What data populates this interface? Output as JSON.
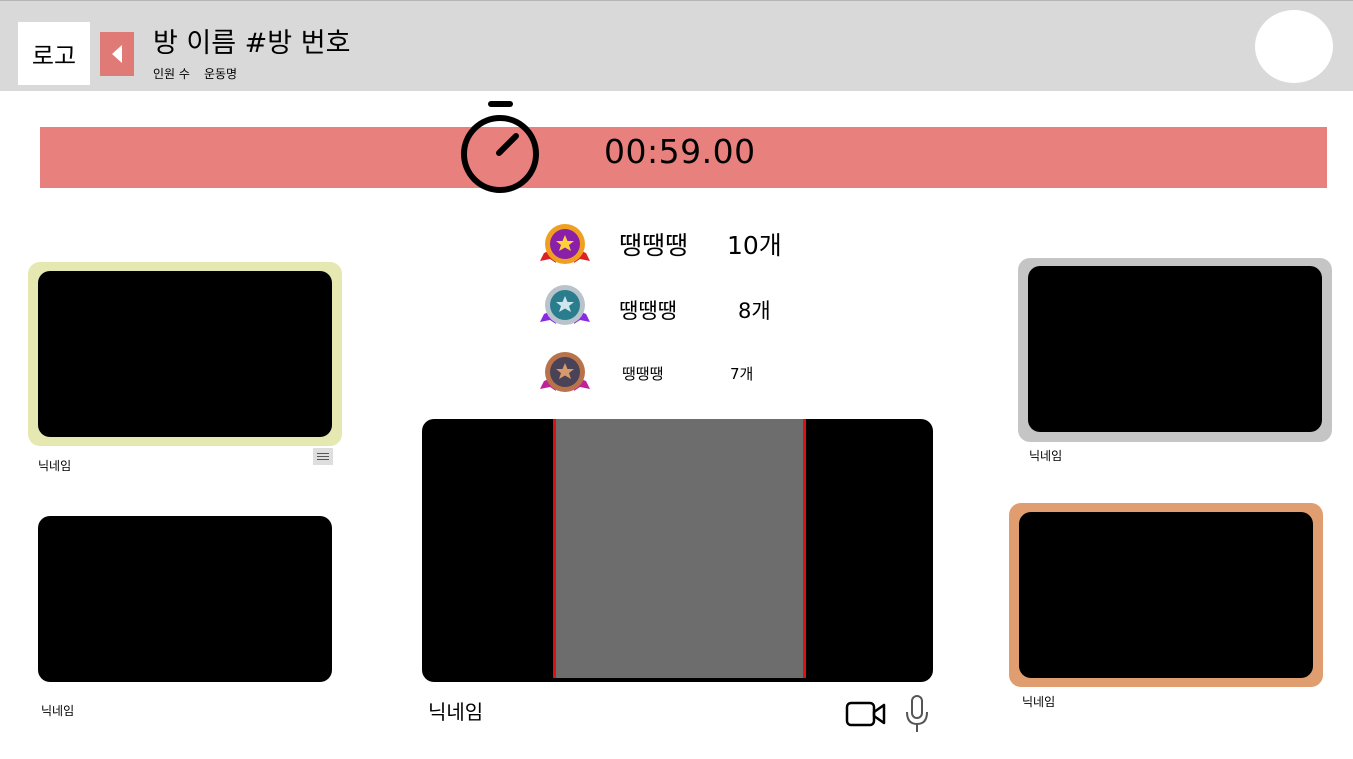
{
  "header": {
    "logo_label": "로고",
    "room_title": "방 이름 #방 번호",
    "member_count_label": "인원 수",
    "exercise_label": "운동명"
  },
  "timer": {
    "time": "00:59.00",
    "bar_color": "#e8807d"
  },
  "ranking": [
    {
      "medal": "gold-medal-icon",
      "name": "땡땡땡",
      "count": "10개"
    },
    {
      "medal": "silver-medal-icon",
      "name": "땡땡땡",
      "count": "8개"
    },
    {
      "medal": "bronze-medal-icon",
      "name": "땡땡땡",
      "count": "7개"
    }
  ],
  "participants": {
    "left_top": {
      "nickname": "닉네임",
      "border_color": "#e5e8b0"
    },
    "left_bottom": {
      "nickname": "닉네임"
    },
    "right_top": {
      "nickname": "닉네임",
      "border_color": "#c5c5c5"
    },
    "right_bottom": {
      "nickname": "닉네임",
      "border_color": "#e09e70"
    }
  },
  "me": {
    "nickname": "닉네임",
    "guide_color": "#e01010"
  },
  "controls": {
    "camera_icon": "video-camera-icon",
    "mic_icon": "microphone-icon"
  }
}
